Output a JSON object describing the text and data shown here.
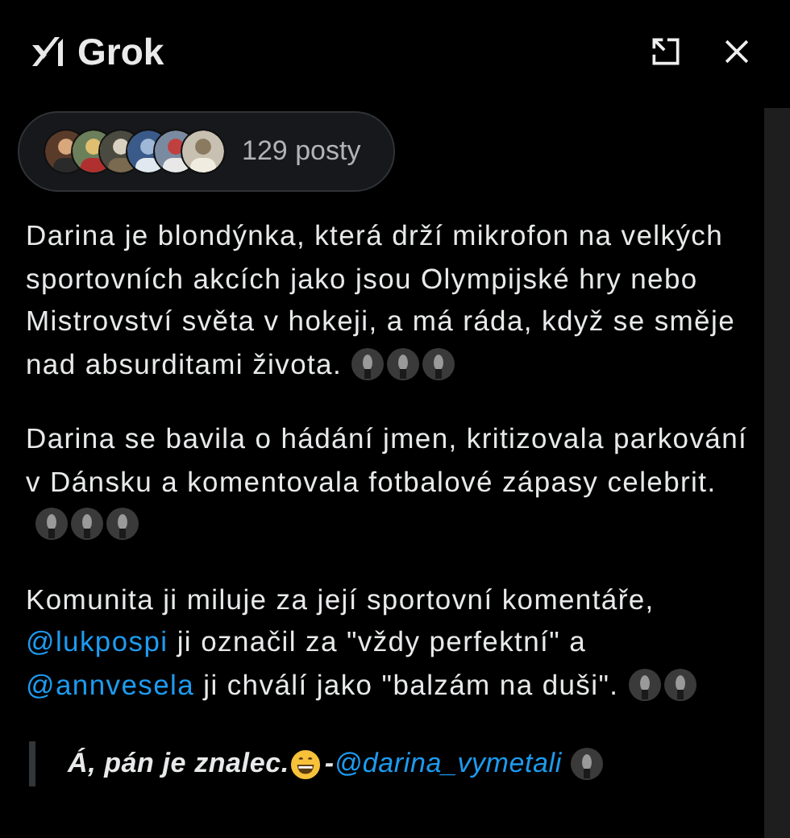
{
  "header": {
    "title": "Grok"
  },
  "sources": {
    "avatars": [
      {
        "kind": "picture"
      },
      {
        "kind": "picture"
      },
      {
        "kind": "picture"
      },
      {
        "kind": "picture"
      },
      {
        "kind": "picture"
      },
      {
        "kind": "picture"
      }
    ],
    "count": "129 posty"
  },
  "paragraphs": [
    {
      "parts": [
        {
          "kind": "text",
          "text": "Darina je blondýnka, která drží mikrofon na velkých sportovních akcích jako jsou Olympijské hry nebo Mistrovství světa v hokeji, a má ráda, když se směje nad absurditami života."
        }
      ],
      "thumbnails": [
        {
          "kind": "picture"
        },
        {
          "kind": "picture"
        },
        {
          "kind": "picture"
        }
      ]
    },
    {
      "parts": [
        {
          "kind": "text",
          "text": "Darina se bavila o hádání jmen, kritizovala parkování v Dánsku a komentovala fotbalové zápasy celebrit."
        }
      ],
      "thumbnails": [
        {
          "kind": "picture"
        },
        {
          "kind": "picture"
        },
        {
          "kind": "picture"
        }
      ]
    },
    {
      "parts": [
        {
          "kind": "text",
          "text": "Komunita ji miluje za její sportovní komentáře, "
        },
        {
          "kind": "mention",
          "text": "@lukpospi"
        },
        {
          "kind": "text",
          "text": " ji označil za \"vždy perfektní\" a "
        },
        {
          "kind": "mention",
          "text": "@annvesela"
        },
        {
          "kind": "text",
          "text": " ji chválí jako \"balzám na duši\"."
        }
      ],
      "thumbnails": [
        {
          "kind": "picture"
        },
        {
          "kind": "picture"
        }
      ]
    }
  ],
  "quote": {
    "text": "Á, pán je znalec.",
    "separator": "-",
    "mention": "@darina_vymetali",
    "thumbnails": [
      {
        "kind": "picture"
      }
    ]
  }
}
